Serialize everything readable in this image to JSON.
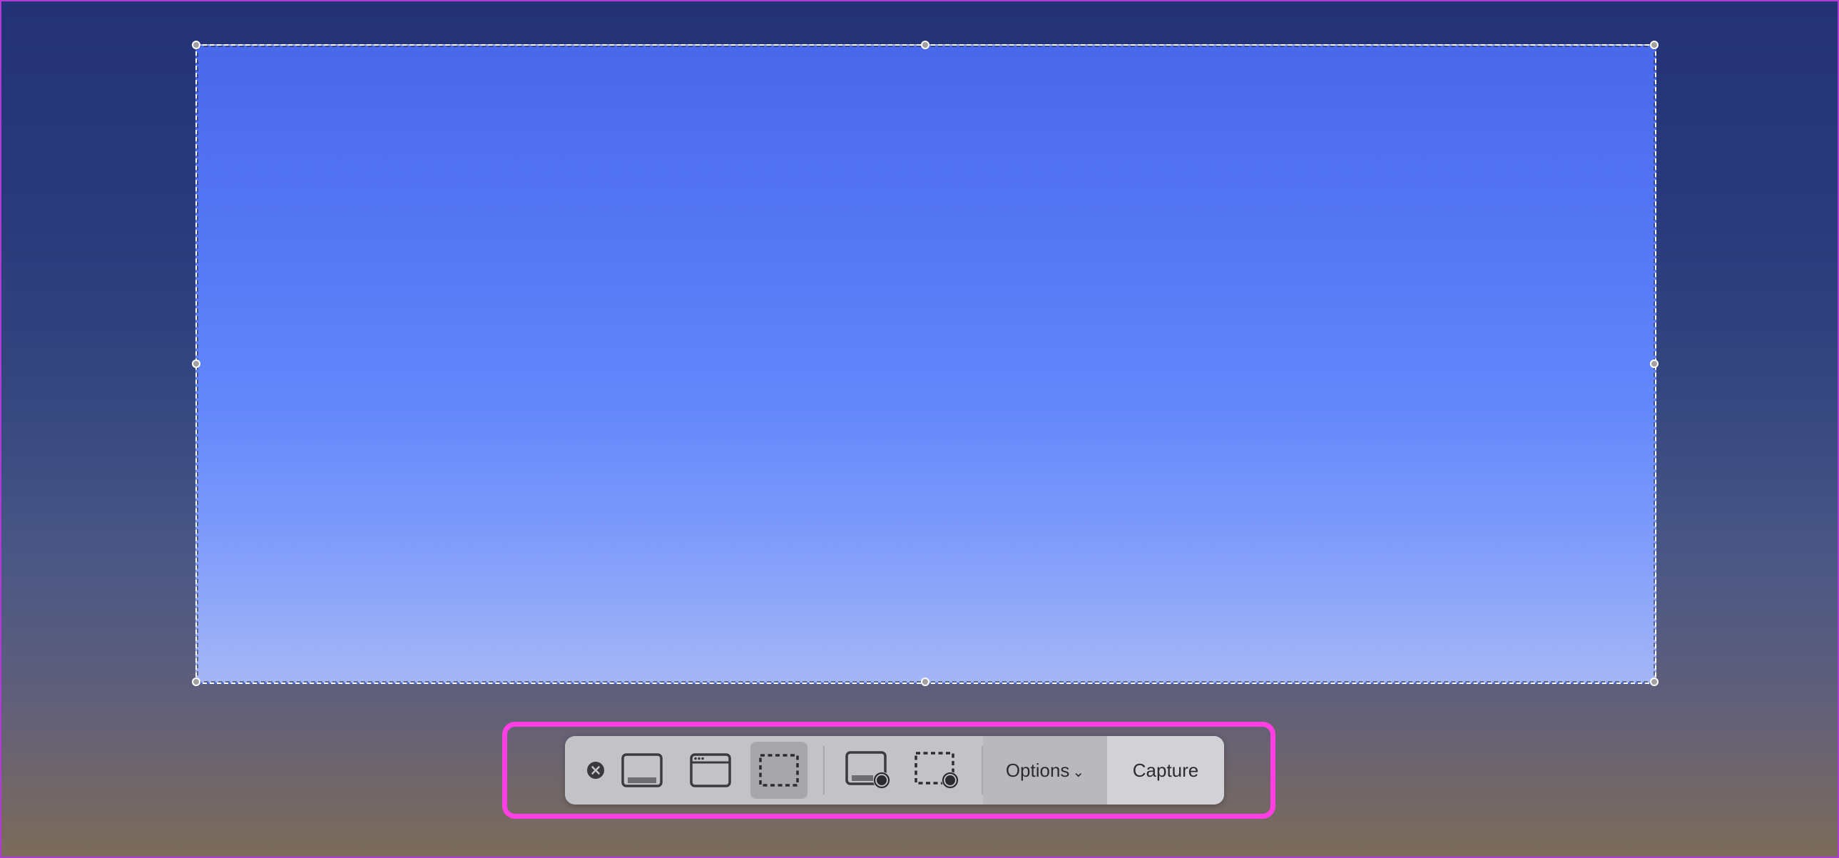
{
  "toolbar": {
    "close_icon": "close-circle-icon",
    "buttons": [
      {
        "name": "capture-entire-screen",
        "icon": "screen-icon",
        "selected": false
      },
      {
        "name": "capture-selected-window",
        "icon": "window-icon",
        "selected": false
      },
      {
        "name": "capture-selected-portion",
        "icon": "dashed-selection-icon",
        "selected": true
      },
      {
        "name": "record-entire-screen",
        "icon": "screen-record-icon",
        "selected": false
      },
      {
        "name": "record-selected-portion",
        "icon": "selection-record-icon",
        "selected": false
      }
    ],
    "options_label": "Options",
    "options_chevron": "⌄",
    "capture_label": "Capture"
  },
  "colors": {
    "highlight_frame": "#ff3fe3",
    "selection_border": "#ffffff",
    "toolbar_bg": "#c3c3c7"
  }
}
